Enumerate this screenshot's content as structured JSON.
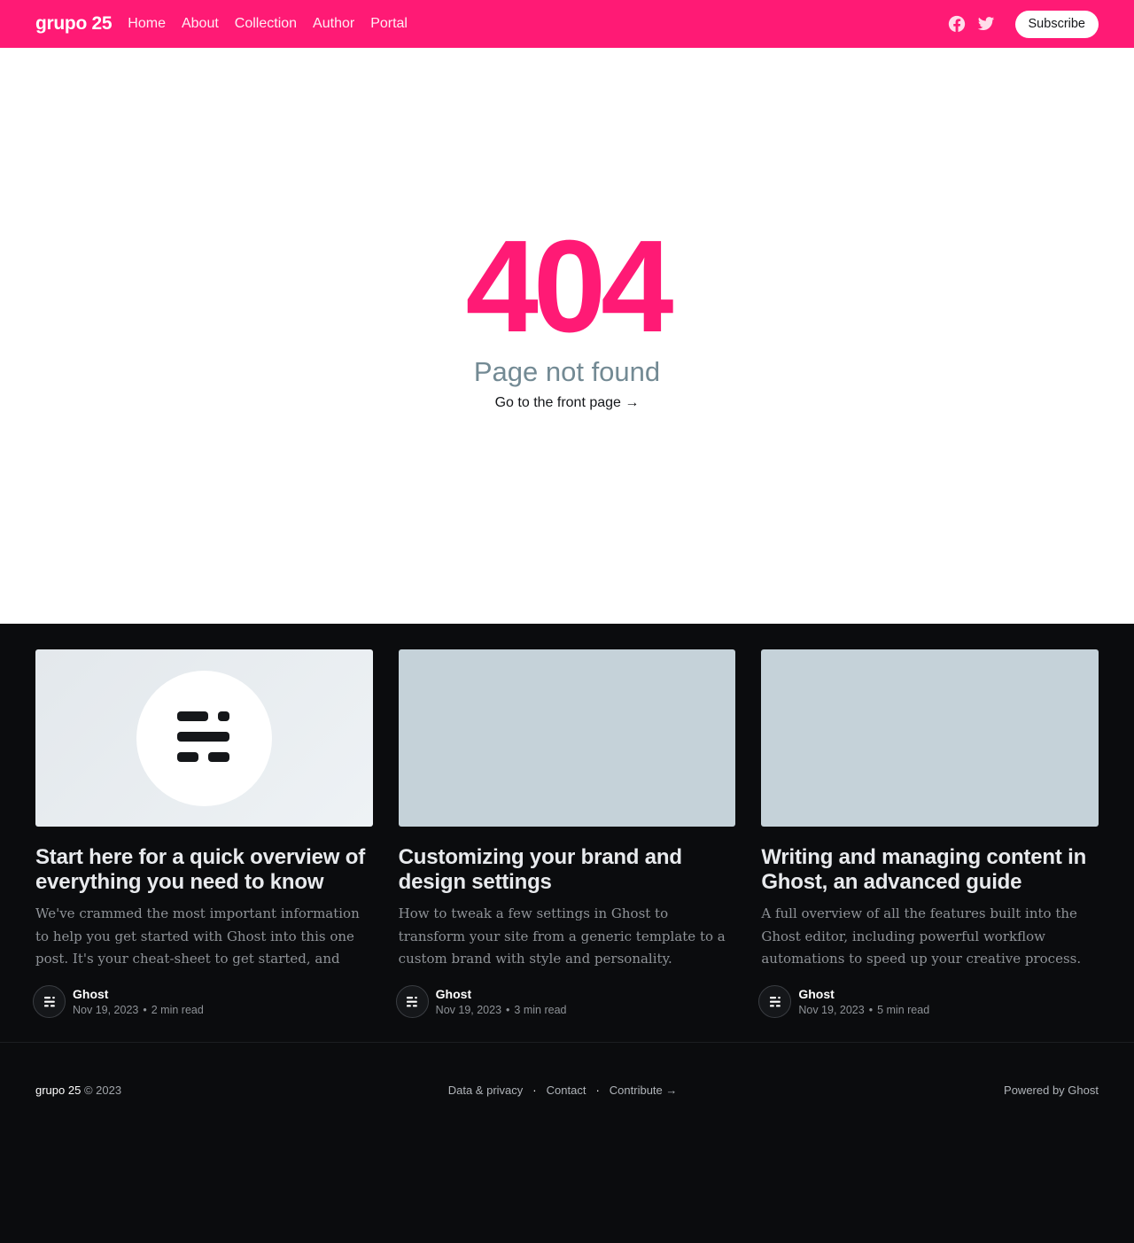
{
  "header": {
    "site_title": "grupo 25",
    "nav": [
      {
        "label": "Home"
      },
      {
        "label": "About"
      },
      {
        "label": "Collection"
      },
      {
        "label": "Author"
      },
      {
        "label": "Portal"
      }
    ],
    "social": [
      {
        "icon": "facebook-icon"
      },
      {
        "icon": "twitter-icon"
      }
    ],
    "subscribe_label": "Subscribe",
    "accent_color": "#ff1a75"
  },
  "error": {
    "code": "404",
    "description": "Page not found",
    "link_label": "Go to the front page →"
  },
  "posts": [
    {
      "title": "Start here for a quick overview of everything you need to know",
      "excerpt": "We've crammed the most important information to help you get started with Ghost into this one post. It's your cheat-sheet to get started, and your shortcut to…",
      "author": "Ghost",
      "date": "Nov 19, 2023",
      "reading_time": "2 min read"
    },
    {
      "title": "Customizing your brand and design settings",
      "excerpt": "How to tweak a few settings in Ghost to transform your site from a generic template to a custom brand with style and personality.",
      "author": "Ghost",
      "date": "Nov 19, 2023",
      "reading_time": "3 min read"
    },
    {
      "title": "Writing and managing content in Ghost, an advanced guide",
      "excerpt": "A full overview of all the features built into the Ghost editor, including powerful workflow automations to speed up your creative process.",
      "author": "Ghost",
      "date": "Nov 19, 2023",
      "reading_time": "5 min read"
    }
  ],
  "footer": {
    "brand": "grupo 25",
    "copyright": "© 2023",
    "links": [
      {
        "label": "Data & privacy"
      },
      {
        "label": "Contact"
      },
      {
        "label": "Contribute →"
      }
    ],
    "separator": "·",
    "powered_by": "Powered by Ghost"
  }
}
